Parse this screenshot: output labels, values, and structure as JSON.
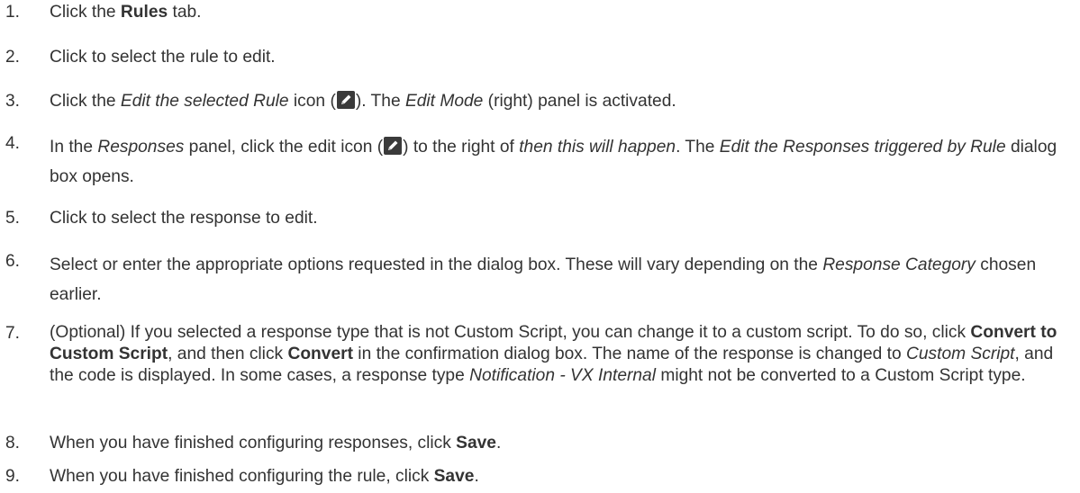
{
  "steps": [
    {
      "number": "1.",
      "parts": [
        {
          "t": "Click the ",
          "s": "n"
        },
        {
          "t": "Rules",
          "s": "b"
        },
        {
          "t": " tab.",
          "s": "n"
        }
      ]
    },
    {
      "number": "2.",
      "parts": [
        {
          "t": "Click to select the rule to edit.",
          "s": "n"
        }
      ]
    },
    {
      "number": "3.",
      "parts": [
        {
          "t": "Click the ",
          "s": "n"
        },
        {
          "t": "Edit the selected Rule",
          "s": "i"
        },
        {
          "t": " icon (",
          "s": "n"
        },
        {
          "icon": "pencil-edit-icon"
        },
        {
          "t": "). The ",
          "s": "n"
        },
        {
          "t": "Edit Mode",
          "s": "i"
        },
        {
          "t": " (right) panel is activated.",
          "s": "n"
        }
      ]
    },
    {
      "number": "4.",
      "parts": [
        {
          "t": "In the ",
          "s": "n"
        },
        {
          "t": "Responses",
          "s": "i"
        },
        {
          "t": " panel, click the edit icon (",
          "s": "n"
        },
        {
          "icon": "pencil-edit-icon"
        },
        {
          "t": ") to the right of ",
          "s": "n"
        },
        {
          "t": "then this will happen",
          "s": "i"
        },
        {
          "t": ". The ",
          "s": "n"
        },
        {
          "t": "Edit the Responses triggered by Rule",
          "s": "i"
        },
        {
          "t": " dialog box opens.",
          "s": "n"
        }
      ]
    },
    {
      "number": "5.",
      "parts": [
        {
          "t": "Click to select the response to edit.",
          "s": "n"
        }
      ]
    },
    {
      "number": "6.",
      "parts": [
        {
          "t": "Select or enter the appropriate options requested in the dialog box. These will vary depending on the ",
          "s": "n"
        },
        {
          "t": "Response Category",
          "s": "i"
        },
        {
          "t": " chosen earlier.",
          "s": "n"
        }
      ]
    },
    {
      "number": "7.",
      "parts": [
        {
          "t": "(Optional) If you selected a response type that is not Custom Script, you can change it to a custom script. To do so, click ",
          "s": "n"
        },
        {
          "t": "Convert to Custom Script",
          "s": "b"
        },
        {
          "t": ", and then click ",
          "s": "n"
        },
        {
          "t": "Convert",
          "s": "b"
        },
        {
          "t": " in the confirmation dialog box. The name of the response is changed to ",
          "s": "n"
        },
        {
          "t": "Custom Script",
          "s": "i"
        },
        {
          "t": ", and the code is displayed. In some cases, a response type ",
          "s": "n"
        },
        {
          "t": "Notification - VX Internal",
          "s": "i"
        },
        {
          "t": " might not be converted to a Custom Script type.",
          "s": "n"
        }
      ]
    },
    {
      "number": "8.",
      "parts": [
        {
          "t": "When you have finished configuring responses, click ",
          "s": "n"
        },
        {
          "t": "Save",
          "s": "b"
        },
        {
          "t": ".",
          "s": "n"
        }
      ]
    },
    {
      "number": "9.",
      "parts": [
        {
          "t": "When you have finished configuring the rule, click ",
          "s": "n"
        },
        {
          "t": "Save",
          "s": "b"
        },
        {
          "t": ".",
          "s": "n"
        }
      ]
    }
  ]
}
